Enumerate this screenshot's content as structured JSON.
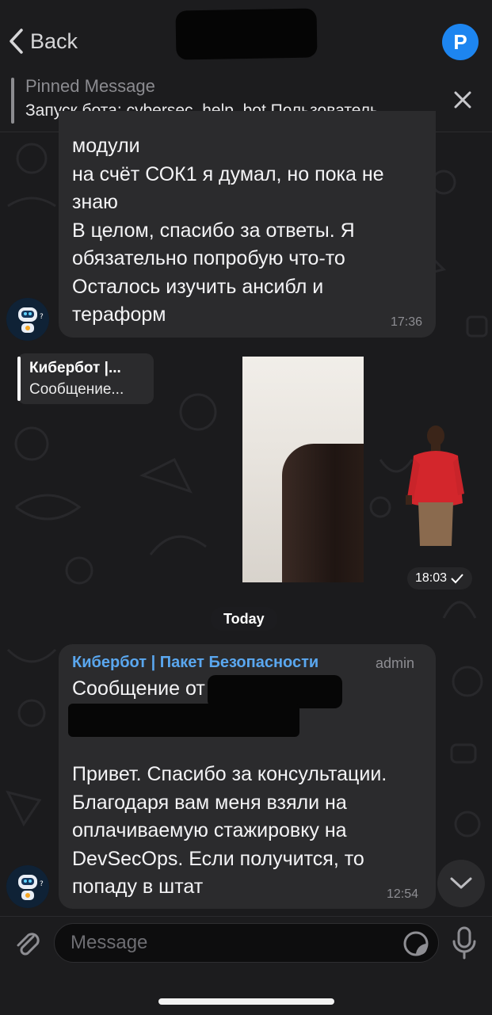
{
  "header": {
    "back_label": "Back",
    "avatar_letter": "P"
  },
  "pinned": {
    "title": "Pinned Message",
    "text": "Запуск бота: cybersec_help_bot Пользователь..."
  },
  "messages": [
    {
      "text": "модули\nна счёт СОК1 я думал, но пока не знаю\nВ целом, спасибо за ответы. Я обязательно попробую что-то\nОсталось изучить ансибл и тераформ",
      "time": "17:36"
    },
    {
      "reply_title": "Кибербот |...",
      "reply_text": "Сообщение...",
      "time": "18:03"
    },
    {
      "sender": "Кибербот | Пакет Безопасности",
      "badge": "admin",
      "text_head": "Сообщение от",
      "text": "Привет. Спасибо за консультации. Благодаря вам меня взяли на оплачиваемую стажировку на DevSecOps. Если получится, то попаду в штат",
      "time": "12:54"
    }
  ],
  "date_separator": "Today",
  "composer": {
    "placeholder": "Message"
  },
  "colors": {
    "accent": "#1d85f0",
    "sender": "#5aa7ef",
    "bubble": "#2b2b2d",
    "background": "#1b1b1d"
  }
}
